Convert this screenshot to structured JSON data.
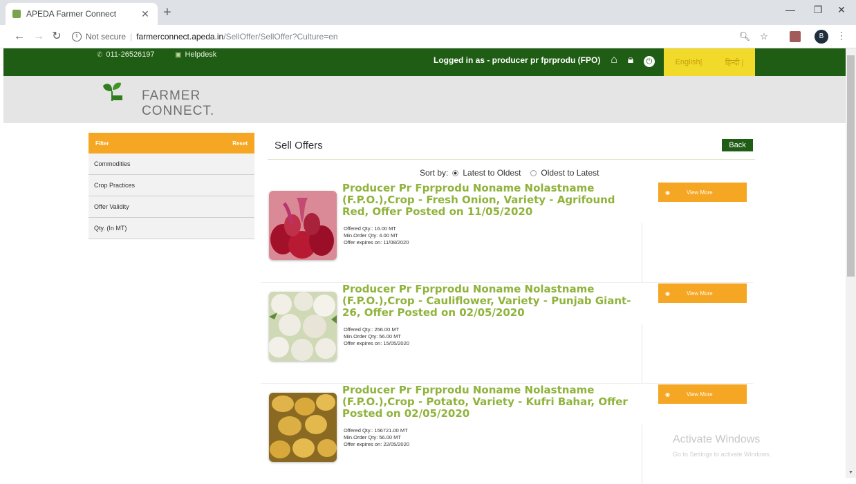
{
  "browser": {
    "tab_title": "APEDA Farmer Connect",
    "url_security": "Not secure",
    "url_domain": "farmerconnect.apeda.in",
    "url_path": "/SellOffer/SellOffer?Culture=en",
    "profile_initial": "B"
  },
  "header": {
    "phone": "011-26526197",
    "helpdesk": "Helpdesk",
    "logged_in": "Logged in as - producer pr fprprodu (FPO)",
    "lang_english": "English|",
    "lang_hindi": "हिन्दी |"
  },
  "brand": {
    "line1": "FARMER",
    "line2": "CONNECT."
  },
  "sidebar": {
    "filter_label": "Filter",
    "reset_label": "Reset",
    "items": [
      {
        "label": "Commodities"
      },
      {
        "label": "Crop Practices"
      },
      {
        "label": "Offer Validity"
      },
      {
        "label": "Qty. (In MT)"
      }
    ]
  },
  "main": {
    "title": "Sell Offers",
    "back_label": "Back",
    "sort_label": "Sort by:",
    "sort_options": [
      "Latest to Oldest",
      "Oldest to Latest"
    ],
    "offers": [
      {
        "title": "Producer Pr Fprprodu Noname Nolastname (F.P.O.),Crop - Fresh Onion, Variety - Agrifound Red, Offer Posted on 11/05/2020",
        "offered_qty": "Offered Qty.: 16.00 MT",
        "min_order": "Min.Order Qty: 4.00 MT",
        "expires": "Offer expires on: 11/08/2020",
        "view_label": "View More"
      },
      {
        "title": "Producer Pr Fprprodu Noname Nolastname (F.P.O.),Crop - Cauliflower, Variety - Punjab Giant-26, Offer Posted on 02/05/2020",
        "offered_qty": "Offered Qty.: 256.00 MT",
        "min_order": "Min.Order Qty: 56.00 MT",
        "expires": "Offer expires on: 15/05/2020",
        "view_label": "View More"
      },
      {
        "title": "Producer Pr Fprprodu Noname Nolastname (F.P.O.),Crop - Potato, Variety - Kufri Bahar, Offer Posted on 02/05/2020",
        "offered_qty": "Offered Qty.: 156721.00 MT",
        "min_order": "Min.Order Qty: 56.00 MT",
        "expires": "Offer expires on: 22/05/2020",
        "view_label": "View More"
      }
    ]
  },
  "watermark": {
    "line1": "Activate Windows",
    "line2": "Go to Settings to activate Windows."
  }
}
